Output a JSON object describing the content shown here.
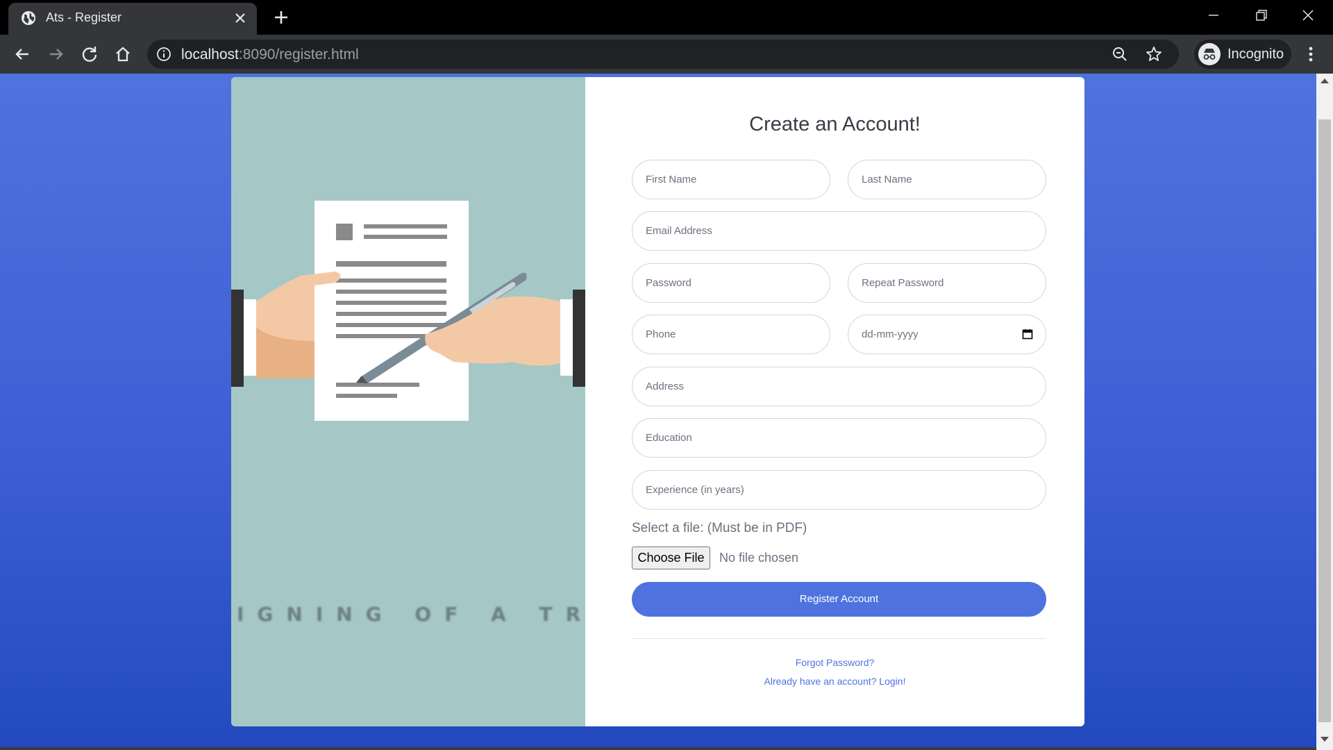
{
  "browser": {
    "tab_title": "Ats - Register",
    "url_host": "localhost",
    "url_rest": ":8090/register.html",
    "profile_label": "Incognito"
  },
  "page": {
    "image_caption": "IGNING OF A TREATY",
    "title": "Create an Account!",
    "fields": {
      "first_name": "First Name",
      "last_name": "Last Name",
      "email": "Email Address",
      "password": "Password",
      "repeat_password": "Repeat Password",
      "phone": "Phone",
      "dob": "dd-mm-yyyy",
      "address": "Address",
      "education": "Education",
      "experience": "Experience (in years)"
    },
    "file_label": "Select a file: (Must be in PDF)",
    "file_button": "Choose File",
    "file_status": "No file chosen",
    "register_button": "Register Account",
    "forgot_link": "Forgot Password?",
    "login_link": "Already have an account? Login!"
  },
  "colors": {
    "primary": "#4e73df",
    "image_bg": "#a5c8c7"
  }
}
